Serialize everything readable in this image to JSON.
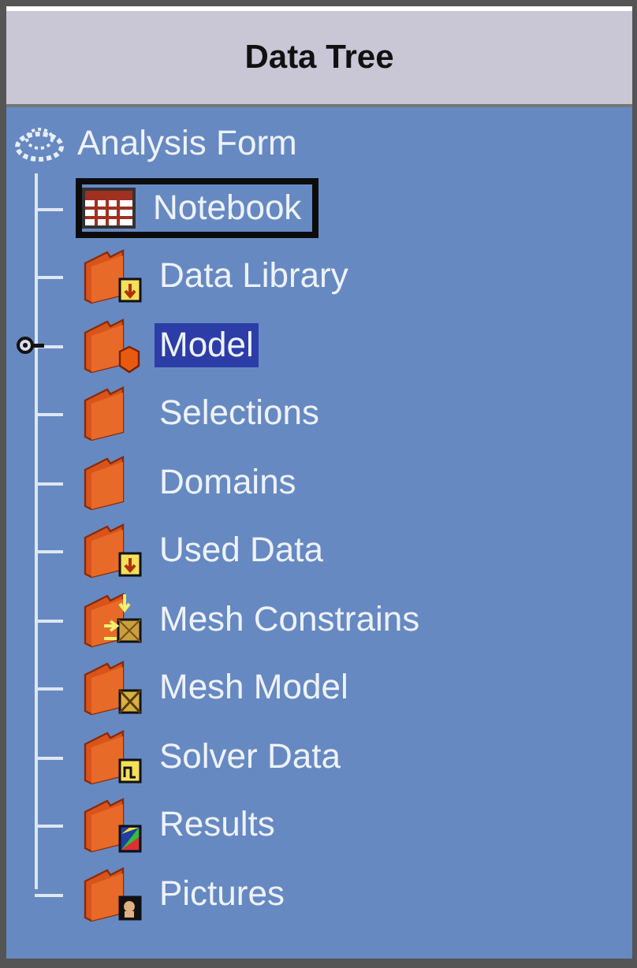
{
  "header": {
    "title": "Data Tree"
  },
  "root": {
    "label": "Analysis Form"
  },
  "items": [
    {
      "label": "Notebook",
      "kind": "notebook",
      "selected": false,
      "focused": true,
      "expandable": false
    },
    {
      "label": "Data Library",
      "kind": "import",
      "selected": false,
      "focused": false,
      "expandable": false
    },
    {
      "label": "Model",
      "kind": "part",
      "selected": true,
      "focused": false,
      "expandable": true
    },
    {
      "label": "Selections",
      "kind": "plain",
      "selected": false,
      "focused": false,
      "expandable": false
    },
    {
      "label": "Domains",
      "kind": "plain",
      "selected": false,
      "focused": false,
      "expandable": false
    },
    {
      "label": "Used Data",
      "kind": "import",
      "selected": false,
      "focused": false,
      "expandable": false
    },
    {
      "label": "Mesh Constrains",
      "kind": "constraint",
      "selected": false,
      "focused": false,
      "expandable": false
    },
    {
      "label": "Mesh Model",
      "kind": "mesh",
      "selected": false,
      "focused": false,
      "expandable": false
    },
    {
      "label": "Solver Data",
      "kind": "solver",
      "selected": false,
      "focused": false,
      "expandable": false
    },
    {
      "label": "Results",
      "kind": "results",
      "selected": false,
      "focused": false,
      "expandable": false
    },
    {
      "label": "Pictures",
      "kind": "pictures",
      "selected": false,
      "focused": false,
      "expandable": false
    }
  ]
}
